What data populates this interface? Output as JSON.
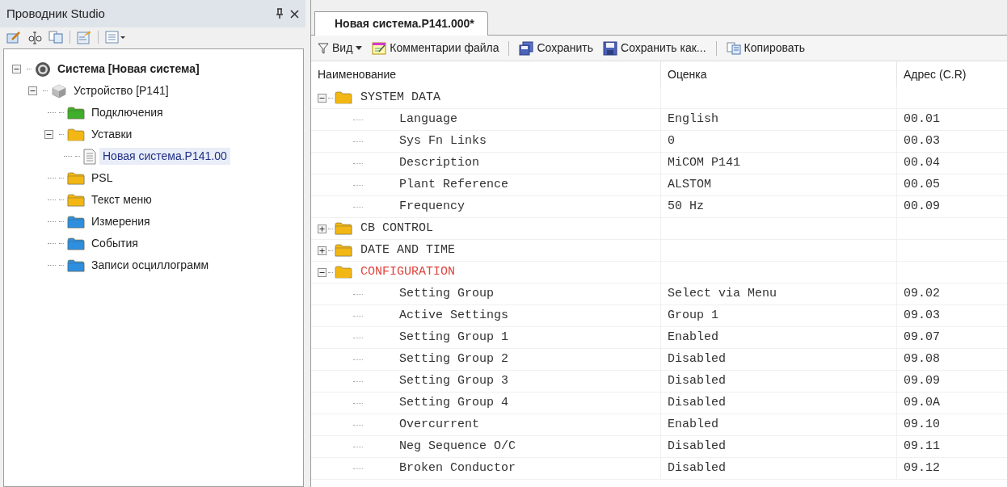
{
  "explorer": {
    "title": "Проводник Studio",
    "tree": [
      {
        "label": "Система [Новая система]",
        "kind": "system",
        "expanded": true,
        "selected": false,
        "children": [
          {
            "label": "Устройство [P141]",
            "kind": "device",
            "expanded": true,
            "selected": false,
            "children": [
              {
                "label": "Подключения",
                "kind": "folder",
                "color": "#3fae2a",
                "selected": false
              },
              {
                "label": "Уставки",
                "kind": "folder-open",
                "color": "#f2b714",
                "expanded": true,
                "selected": false,
                "children": [
                  {
                    "label": "Новая система.P141.00",
                    "kind": "file",
                    "selected": true
                  }
                ]
              },
              {
                "label": "PSL",
                "kind": "folder",
                "color": "#f2b714",
                "selected": false
              },
              {
                "label": "Текст меню",
                "kind": "folder",
                "color": "#f2b714",
                "selected": false
              },
              {
                "label": "Измерения",
                "kind": "folder",
                "color": "#2e8fe0",
                "selected": false
              },
              {
                "label": "События",
                "kind": "folder",
                "color": "#2e8fe0",
                "selected": false
              },
              {
                "label": "Записи осциллограмм",
                "kind": "folder",
                "color": "#2e8fe0",
                "selected": false
              }
            ]
          }
        ]
      }
    ]
  },
  "tabs": [
    {
      "label": "Новая система.P141.000*",
      "selected": true
    }
  ],
  "toolbar": [
    {
      "label": "Вид",
      "kind": "filter",
      "dropdown": true
    },
    {
      "label": "Комментарии файла",
      "kind": "comment",
      "dropdown": false
    },
    {
      "kind": "separator"
    },
    {
      "label": "Сохранить",
      "kind": "save",
      "dropdown": false
    },
    {
      "label": "Сохранить как...",
      "kind": "save-as",
      "dropdown": false
    },
    {
      "kind": "separator"
    },
    {
      "label": "Копировать",
      "kind": "copy",
      "dropdown": false
    }
  ],
  "table": {
    "columns": [
      "Наименование",
      "Оценка",
      "Адрес (C.R)"
    ],
    "groups": [
      {
        "name": "SYSTEM DATA",
        "expanded": true,
        "modified": false,
        "rows": [
          {
            "name": "Language",
            "value": "English",
            "address": "00.01"
          },
          {
            "name": "Sys Fn Links",
            "value": "0",
            "address": "00.03"
          },
          {
            "name": "Description",
            "value": "MiCOM P141",
            "address": "00.04"
          },
          {
            "name": "Plant Reference",
            "value": "ALSTOM",
            "address": "00.05"
          },
          {
            "name": "Frequency",
            "value": "50 Hz",
            "address": "00.09"
          }
        ]
      },
      {
        "name": "CB CONTROL",
        "expanded": false,
        "modified": false
      },
      {
        "name": "DATE AND TIME",
        "expanded": false,
        "modified": false
      },
      {
        "name": "CONFIGURATION",
        "expanded": true,
        "modified": true,
        "rows": [
          {
            "name": "Setting Group",
            "value": "Select via Menu",
            "address": "09.02"
          },
          {
            "name": "Active Settings",
            "value": "Group 1",
            "address": "09.03"
          },
          {
            "name": "Setting Group 1",
            "value": "Enabled",
            "address": "09.07"
          },
          {
            "name": "Setting Group 2",
            "value": "Disabled",
            "address": "09.08"
          },
          {
            "name": "Setting Group 3",
            "value": "Disabled",
            "address": "09.09"
          },
          {
            "name": "Setting Group 4",
            "value": "Disabled",
            "address": "09.0A"
          },
          {
            "name": "Overcurrent",
            "value": "Enabled",
            "address": "09.10"
          },
          {
            "name": "Neg Sequence O/C",
            "value": "Disabled",
            "address": "09.11"
          },
          {
            "name": "Broken Conductor",
            "value": "Disabled",
            "address": "09.12"
          }
        ]
      }
    ]
  }
}
